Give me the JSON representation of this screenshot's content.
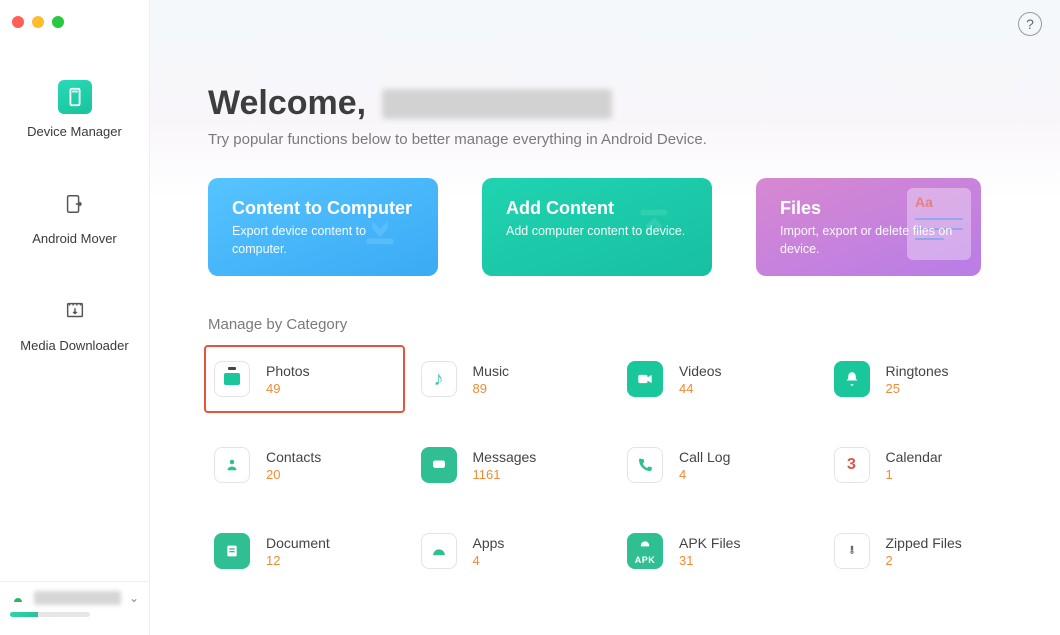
{
  "sidebar": {
    "items": [
      {
        "label": "Device Manager"
      },
      {
        "label": "Android Mover"
      },
      {
        "label": "Media Downloader"
      }
    ]
  },
  "header": {
    "welcome_prefix": "Welcome,",
    "subtitle": "Try popular functions below to better manage everything in Android Device."
  },
  "quick_actions": {
    "c2c": {
      "title": "Content to Computer",
      "desc": "Export device content to computer."
    },
    "add": {
      "title": "Add Content",
      "desc": "Add computer content to device."
    },
    "files": {
      "title": "Files",
      "desc": "Import, export or delete files on device."
    }
  },
  "section_title": "Manage by Category",
  "categories": [
    {
      "name": "Photos",
      "count": "49"
    },
    {
      "name": "Music",
      "count": "89"
    },
    {
      "name": "Videos",
      "count": "44"
    },
    {
      "name": "Ringtones",
      "count": "25"
    },
    {
      "name": "Contacts",
      "count": "20"
    },
    {
      "name": "Messages",
      "count": "1161"
    },
    {
      "name": "Call Log",
      "count": "4"
    },
    {
      "name": "Calendar",
      "count": "1"
    },
    {
      "name": "Document",
      "count": "12"
    },
    {
      "name": "Apps",
      "count": "4"
    },
    {
      "name": "APK Files",
      "count": "31"
    },
    {
      "name": "Zipped Files",
      "count": "2"
    }
  ],
  "help_label": "?",
  "calendar_glyph": "3",
  "apk_badge": "APK",
  "colors": {
    "accent_green": "#19c79b",
    "highlight_border": "#e5553b",
    "count_orange": "#f08a34"
  }
}
